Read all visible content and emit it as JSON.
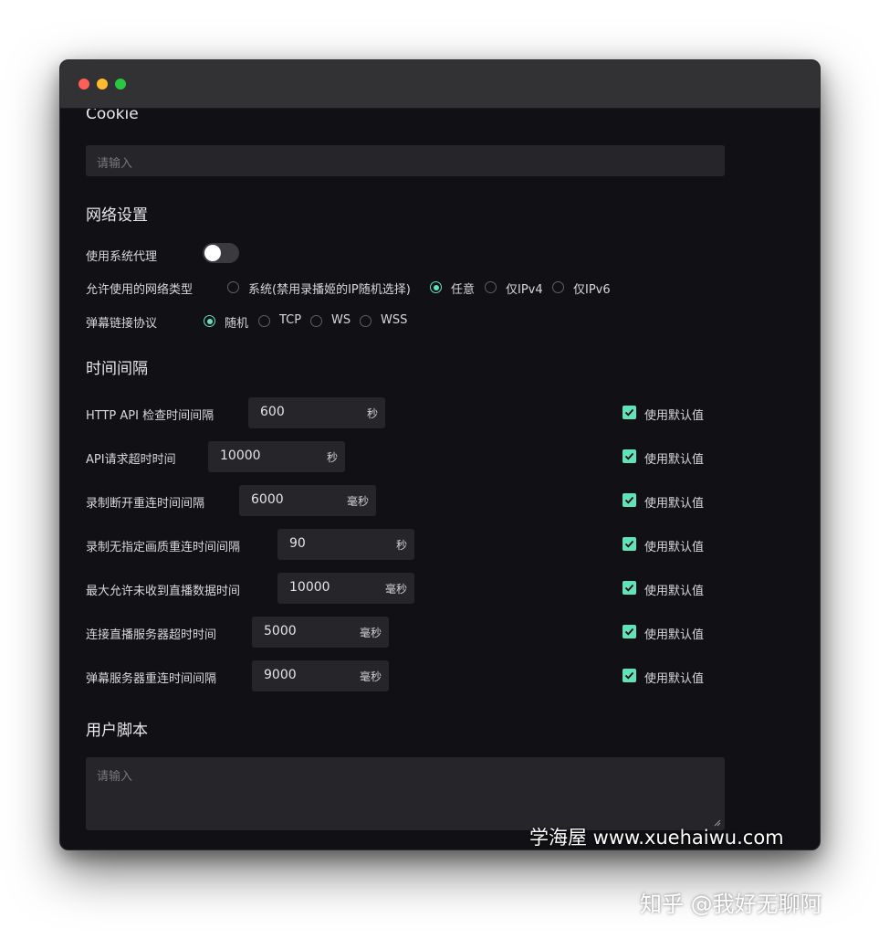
{
  "window": {
    "traffic_lights": {
      "close_color": "#fe5f57",
      "minimize_color": "#febb2e",
      "zoom_color": "#2ac840"
    }
  },
  "cookie": {
    "heading": "Cookie",
    "placeholder": "请输入"
  },
  "network": {
    "heading": "网络设置",
    "system_proxy": {
      "label": "使用系统代理",
      "enabled": false
    },
    "network_type": {
      "label": "允许使用的网络类型",
      "options": [
        "系统(禁用录播姬的IP随机选择)",
        "任意",
        "仅IPv4",
        "仅IPv6"
      ],
      "selected": "任意"
    },
    "danmaku_protocol": {
      "label": "弹幕链接协议",
      "options": [
        "随机",
        "TCP",
        "WS",
        "WSS"
      ],
      "selected": "随机"
    }
  },
  "intervals": {
    "heading": "时间间隔",
    "default_label": "使用默认值",
    "rows": [
      {
        "label": "HTTP API 检查时间间隔",
        "value": "600",
        "unit": "秒",
        "use_default": true
      },
      {
        "label": "API请求超时时间",
        "value": "10000",
        "unit": "秒",
        "use_default": true
      },
      {
        "label": "录制断开重连时间间隔",
        "value": "6000",
        "unit": "毫秒",
        "use_default": true
      },
      {
        "label": "录制无指定画质重连时间间隔",
        "value": "90",
        "unit": "秒",
        "use_default": true
      },
      {
        "label": "最大允许未收到直播数据时间",
        "value": "10000",
        "unit": "毫秒",
        "use_default": true
      },
      {
        "label": "连接直播服务器超时时间",
        "value": "5000",
        "unit": "毫秒",
        "use_default": true
      },
      {
        "label": "弹幕服务器重连时间间隔",
        "value": "9000",
        "unit": "毫秒",
        "use_default": true
      }
    ]
  },
  "user_script": {
    "heading": "用户脚本",
    "placeholder": "请输入"
  },
  "colors": {
    "accent": "#63e2b7",
    "background": "#111115",
    "input_bg": "#26262a",
    "titlebar": "#323234"
  },
  "watermarks": {
    "site": "学海屋 www.xuehaiwu.com",
    "zhihu": "知乎 @我好无聊阿"
  }
}
